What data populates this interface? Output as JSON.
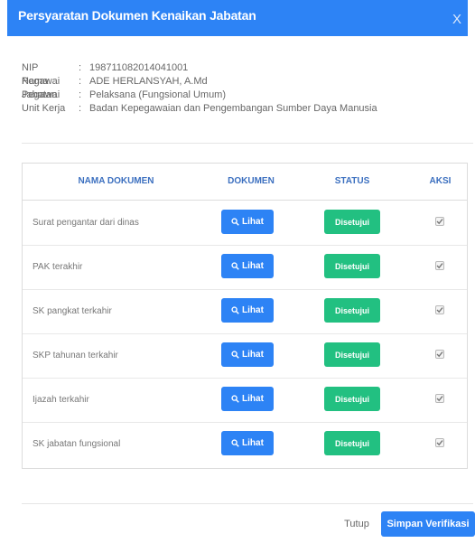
{
  "modal": {
    "title": "Persyaratan Dokumen Kenaikan Jabatan",
    "close_symbol": "X",
    "icons": {
      "close": "close-icon",
      "search": "search-icon",
      "check": "check-icon"
    },
    "colors": {
      "primary": "#2d83f5",
      "success": "#22c081"
    }
  },
  "employee": {
    "rows": [
      {
        "label": "NIP Pegawai",
        "sep": ":",
        "value": "198711082014041001"
      },
      {
        "label": "Nama Pegawai",
        "sep": ":",
        "value": "ADE HERLANSYAH, A.Md"
      },
      {
        "label": "Jabatan",
        "sep": ":",
        "value": "Pelaksana (Fungsional Umum)"
      },
      {
        "label": "Unit Kerja",
        "sep": ":",
        "value": "Badan Kepegawaian dan Pengembangan Sumber Daya Manusia"
      }
    ]
  },
  "table": {
    "headers": {
      "name": "NAMA DOKUMEN",
      "doc": "DOKUMEN",
      "status": "STATUS",
      "aksi": "AKSI"
    },
    "rows": [
      {
        "name": "Surat pengantar dari dinas",
        "button": "Lihat",
        "status": "Disetujui",
        "checked": true
      },
      {
        "name": "PAK terakhir",
        "button": "Lihat",
        "status": "Disetujui",
        "checked": true
      },
      {
        "name": "SK pangkat terkahir",
        "button": "Lihat",
        "status": "Disetujui",
        "checked": true
      },
      {
        "name": "SKP tahunan terkahir",
        "button": "Lihat",
        "status": "Disetujui",
        "checked": true
      },
      {
        "name": "Ijazah terkahir",
        "button": "Lihat",
        "status": "Disetujui",
        "checked": true
      },
      {
        "name": "SK jabatan fungsional",
        "button": "Lihat",
        "status": "Disetujui",
        "checked": true
      }
    ]
  },
  "footer": {
    "close_label": "Tutup",
    "save_label": "Simpan Verifikasi"
  }
}
